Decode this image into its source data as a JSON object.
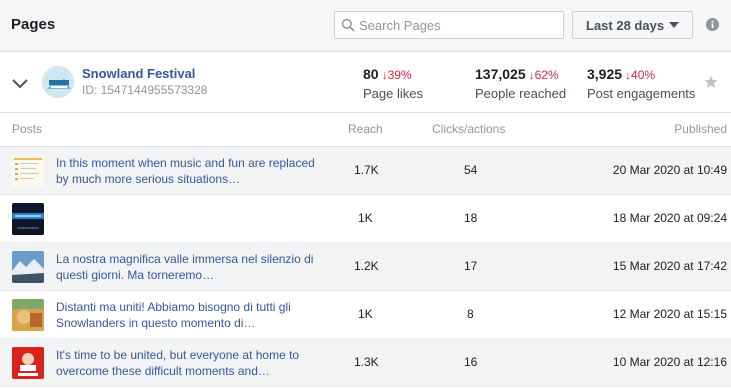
{
  "header": {
    "title": "Pages",
    "search_placeholder": "Search Pages",
    "date_range": "Last 28 days"
  },
  "page": {
    "name": "Snowland Festival",
    "id_text": "ID: 1547144955573328",
    "stats": [
      {
        "value": "80",
        "delta": "39%",
        "label": "Page likes"
      },
      {
        "value": "137,025",
        "delta": "62%",
        "label": "People reached"
      },
      {
        "value": "3,925",
        "delta": "40%",
        "label": "Post engagements"
      }
    ]
  },
  "table": {
    "columns": [
      "Posts",
      "Reach",
      "Clicks/actions",
      "Published"
    ],
    "rows": [
      {
        "text": "In this moment when music and fun are replaced by much more serious situations…",
        "reach": "1.7K",
        "clicks": "54",
        "published": "20 Mar 2020 at 10:49"
      },
      {
        "text": "",
        "reach": "1K",
        "clicks": "18",
        "published": "18 Mar 2020 at 09:24"
      },
      {
        "text": "La nostra magnifica valle immersa nel silenzio di questi giorni. Ma torneremo…",
        "reach": "1.2K",
        "clicks": "17",
        "published": "15 Mar 2020 at 17:42"
      },
      {
        "text": "Distanti ma uniti! Abbiamo bisogno di tutti gli Snowlanders in questo momento di…",
        "reach": "1K",
        "clicks": "8",
        "published": "12 Mar 2020 at 15:15"
      },
      {
        "text": "It's time to be united, but everyone at home to overcome these difficult moments and…",
        "reach": "1.3K",
        "clicks": "16",
        "published": "10 Mar 2020 at 12:16"
      }
    ]
  },
  "colors": {
    "link": "#365899",
    "negative_delta": "#e41e3f",
    "header_bg": "#f5f6f7"
  }
}
